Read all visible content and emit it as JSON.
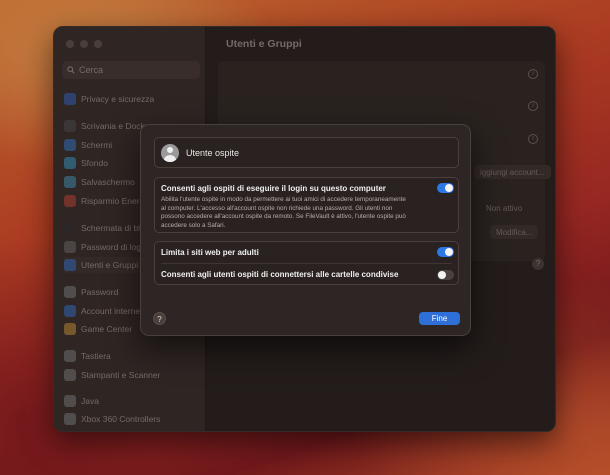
{
  "window": {
    "title": "Utenti e Gruppi"
  },
  "sidebar": {
    "search_placeholder": "Cerca",
    "items": [
      {
        "label": "Privacy e sicurezza",
        "icon": "hand-icon",
        "color": "#3a6fd0"
      },
      {
        "label": "Scrivania e Dock",
        "icon": "dock-icon",
        "color": "#555"
      },
      {
        "label": "Schermi",
        "icon": "sun-icon",
        "color": "#3a84d8"
      },
      {
        "label": "Sfondo",
        "icon": "flower-icon",
        "color": "#3ea6d6"
      },
      {
        "label": "Salvaschermo",
        "icon": "screensaver-icon",
        "color": "#4aa0c8"
      },
      {
        "label": "Risparmio Energ",
        "icon": "battery-icon",
        "color": "#d04a3a"
      },
      {
        "label": "Schermata di bl",
        "icon": "lock-icon",
        "color": "#333"
      },
      {
        "label": "Password di log",
        "icon": "key-icon",
        "color": "#777"
      },
      {
        "label": "Utenti e Gruppi",
        "icon": "users-icon",
        "color": "#3a7ad8"
      },
      {
        "label": "Password",
        "icon": "password-key-icon",
        "color": "#888"
      },
      {
        "label": "Account interne",
        "icon": "at-icon",
        "color": "#3a7ad8"
      },
      {
        "label": "Game Center",
        "icon": "game-center-icon",
        "color": "#d8a040"
      },
      {
        "label": "Tastiera",
        "icon": "keyboard-icon",
        "color": "#888"
      },
      {
        "label": "Stampanti e Scanner",
        "icon": "printer-icon",
        "color": "#888"
      },
      {
        "label": "Java",
        "icon": "java-icon",
        "color": "#888"
      },
      {
        "label": "Xbox 360 Controllers",
        "icon": "gamepad-icon",
        "color": "#888"
      }
    ]
  },
  "content": {
    "add_account_label": "iggiungi account...",
    "guest_status": "Non attivo",
    "modify_label": "Modifica..."
  },
  "dialog": {
    "user_name": "Utente ospite",
    "options": {
      "allow_login": {
        "title": "Consenti agli ospiti di eseguire il login su questo computer",
        "description": "Abilita l'utente ospite in modo da permettere ai tuoi amici di accedere temporaneamente al computer. L'accesso all'account ospite non richiede una password. Gli utenti non possono accedere all'account ospite da remoto. Se FileVault è attivo, l'utente ospite può accedere solo a Safari.",
        "enabled": true
      },
      "limit_adult_sites": {
        "title": "Limita i siti web per adulti",
        "enabled": true
      },
      "shared_folders": {
        "title": "Consenti agli utenti ospiti di connettersi alle cartelle condivise",
        "enabled": false
      }
    },
    "help_label": "?",
    "done_label": "Fine"
  }
}
